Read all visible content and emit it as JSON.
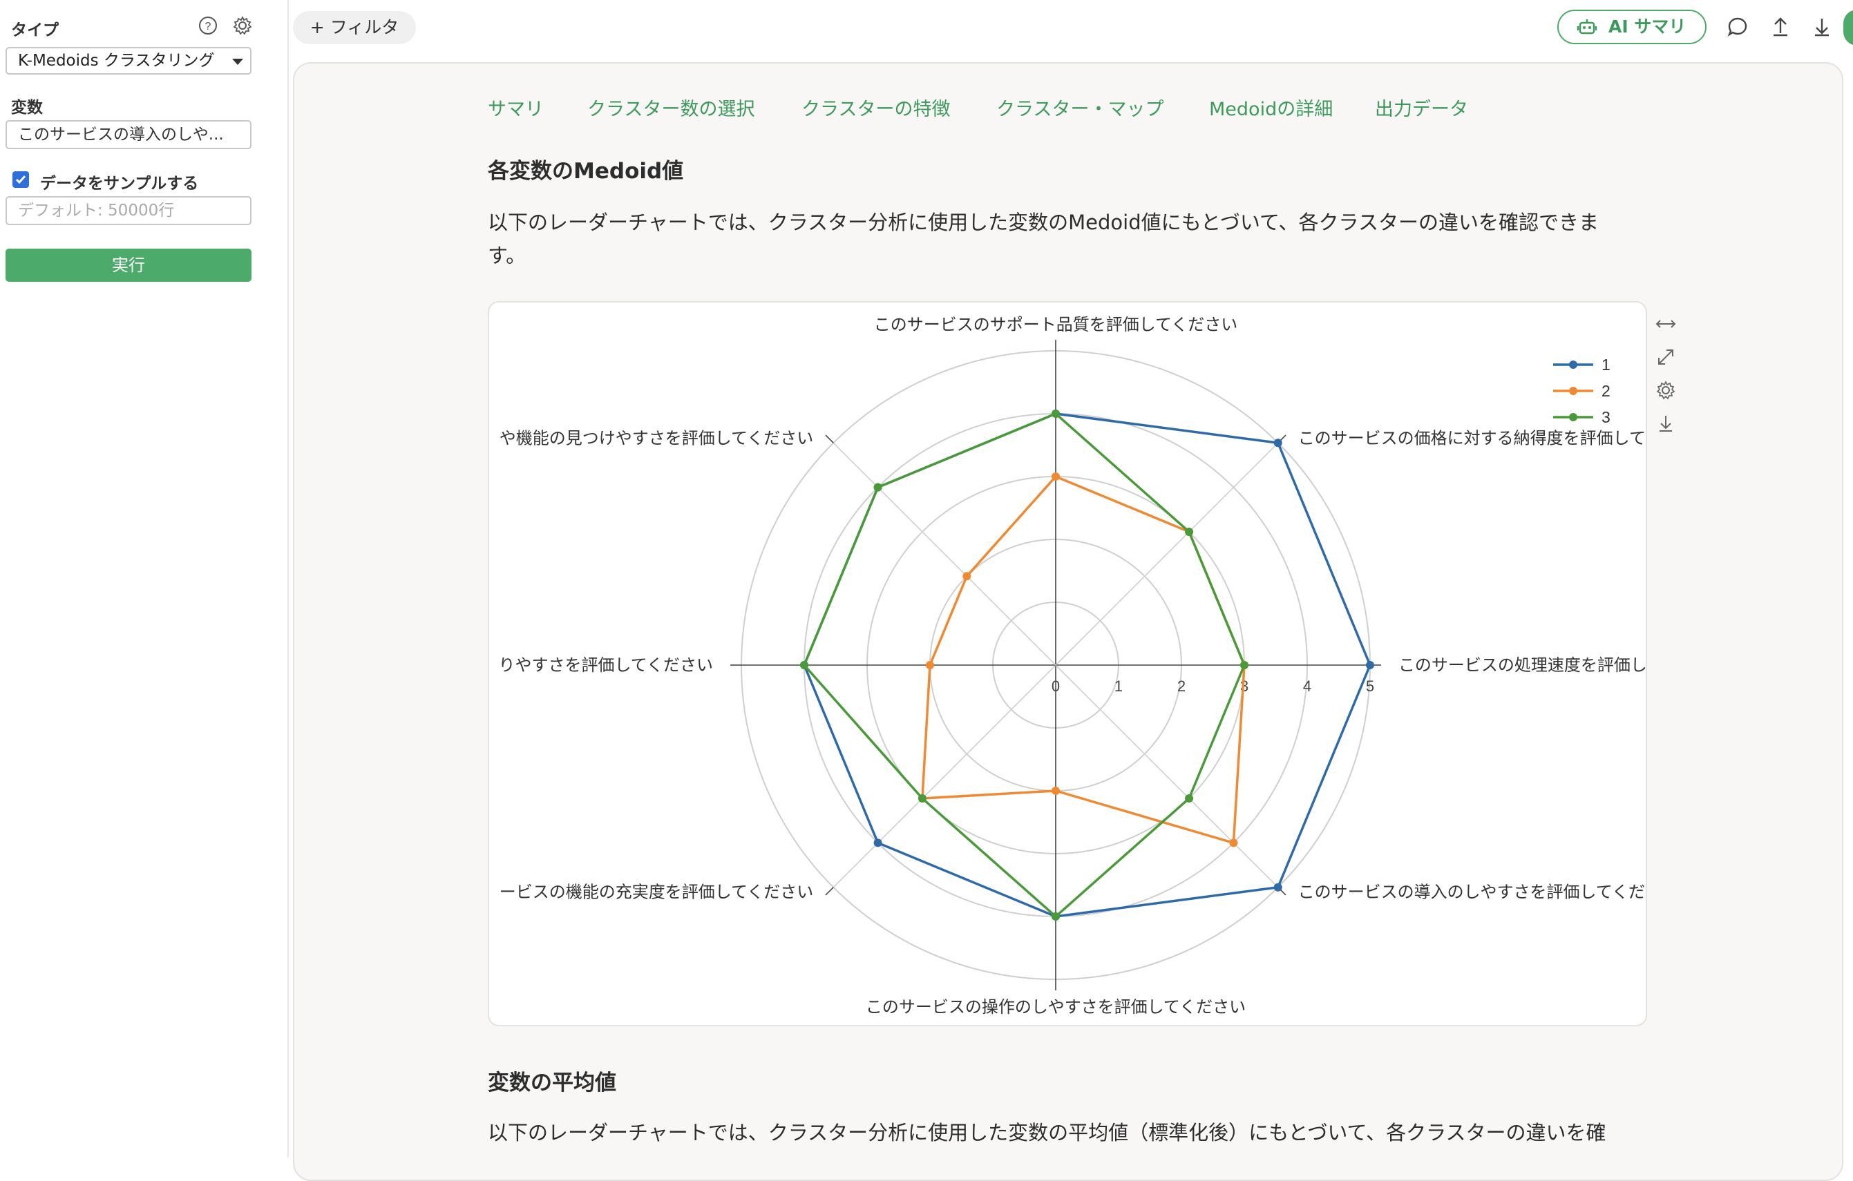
{
  "sidebar": {
    "type_label": "タイプ",
    "type_value": "K-Medoids クラスタリング",
    "variable_label": "変数",
    "variable_value": "このサービスの導入のしや...",
    "sample_label": "データをサンプルする",
    "sample_checked": true,
    "sample_placeholder": "デフォルト: 50000行",
    "run_label": "実行",
    "icons": [
      "help-icon",
      "gear-icon"
    ]
  },
  "topbar": {
    "filter_label": "+ フィルタ",
    "ai_summary_label": "AI サマリ",
    "icons": [
      "comment-icon",
      "upload-icon",
      "download-icon"
    ],
    "accent_color": "#4caa6a"
  },
  "tabs": [
    "サマリ",
    "クラスター数の選択",
    "クラスターの特徴",
    "クラスター・マップ",
    "Medoidの詳細",
    "出力データ"
  ],
  "section1": {
    "heading": "各変数のMedoid値",
    "description": "以下のレーダーチャートでは、クラスター分析に使用した変数のMedoid値にもとづいて、各クラスターの違いを確認できます。",
    "description_line1": "以下のレーダーチャートでは、クラスター分析に使用した変数のMedoid値にもとづいて、各クラスターの違いを確認できま",
    "description_line2": "す。"
  },
  "section2": {
    "heading": "変数の平均値",
    "description_line1": "以下のレーダーチャートでは、クラスター分析に使用した変数の平均値（標準化後）にもとづいて、各クラスターの違いを確"
  },
  "chart_tools": [
    "horizontal-resize-icon",
    "expand-icon",
    "settings-icon",
    "download-icon"
  ],
  "chart_data": {
    "type": "radar",
    "axes": [
      "このサービスのサポート品質を評価してください",
      "このサービスの価格に対する納得度を評価してください",
      "このサービスの処理速度を評価してください",
      "このサービスの導入のしやすさを評価してください",
      "このサービスの操作のしやすさを評価してください",
      "このサービスの機能の充実度を評価してください",
      "このサービスの分かりやすさを評価してください",
      "このサービスの設定や機能の見つけやすさを評価してください"
    ],
    "axis_labels_visible": [
      "このサービスのサポート品質を評価してください",
      "このサービスの価格に対する納得度を評価して",
      "このサービスの処理速度を評価し",
      "このサービスの導入のしやすさを評価してくだ",
      "このサービスの操作のしやすさを評価してください",
      "ービスの機能の充実度を評価してください",
      "りやすさを評価してください",
      "や機能の見つけやすさを評価してください"
    ],
    "radial_ticks": [
      0,
      1,
      2,
      3,
      4,
      5
    ],
    "range": [
      0,
      5
    ],
    "series": [
      {
        "name": "1",
        "color": "#2f6aa8",
        "values": [
          4,
          5,
          5,
          5,
          4,
          4,
          4,
          4
        ]
      },
      {
        "name": "2",
        "color": "#ef8a32",
        "values": [
          3,
          3,
          3,
          4,
          2,
          3,
          2,
          2
        ]
      },
      {
        "name": "3",
        "color": "#4a9a3a",
        "values": [
          4,
          3,
          3,
          3,
          4,
          3,
          4,
          4
        ]
      }
    ],
    "legend_position": "top-right",
    "grid": true
  }
}
